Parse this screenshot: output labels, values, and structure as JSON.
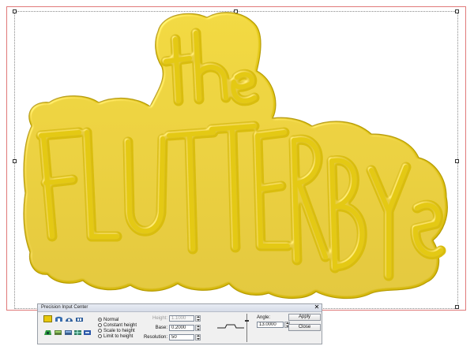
{
  "artwork": {
    "text_top": "the",
    "text_bottom": "FLUTTERBYE",
    "fill_color": "#e2c50f",
    "shade_color": "#b89c06"
  },
  "dialog": {
    "title": "Precision Input Center",
    "close_glyph": "✕",
    "modes": [
      {
        "label": "Normal",
        "selected": true
      },
      {
        "label": "Constant height",
        "selected": false
      },
      {
        "label": "Scale to height",
        "selected": false
      },
      {
        "label": "Limit to height",
        "selected": false
      }
    ],
    "height": {
      "label": "Height:",
      "value": "1.1000",
      "enabled": false
    },
    "base": {
      "label": "Base:",
      "value": "0.2000"
    },
    "resolution": {
      "label": "Resolution:",
      "value": "50"
    },
    "angle": {
      "label": "Angle:",
      "value": "13.0000"
    },
    "apply_label": "Apply",
    "close_label": "Close",
    "swatch_color": "#e8c80c"
  }
}
